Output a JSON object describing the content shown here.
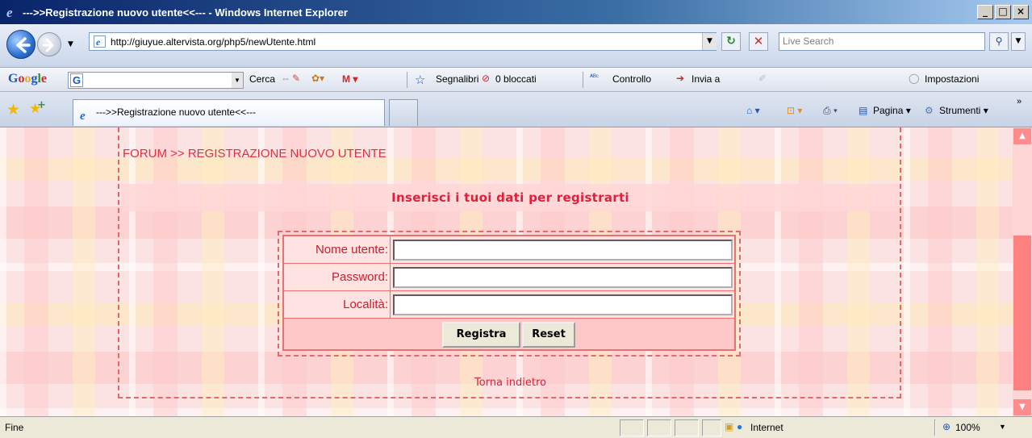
{
  "window": {
    "title": "--->>Registrazione nuovo utente<<--- - Windows Internet Explorer",
    "controls": [
      "_",
      "□",
      "×"
    ]
  },
  "address_bar": {
    "url": "http://giuyue.altervista.org/php5/newUtente.html",
    "search_placeholder": "Live Search"
  },
  "google_toolbar": {
    "search_button": "Cerca",
    "bookmarks": "Segnalibri",
    "blocked": "0 bloccati",
    "spellcheck": "Controllo",
    "send_to": "Invia a",
    "settings": "Impostazioni"
  },
  "tabs": {
    "active_tab": "--->>Registrazione nuovo utente<<---"
  },
  "command_bar": {
    "page": "Pagina",
    "tools": "Strumenti"
  },
  "page": {
    "breadcrumb": "FORUM >> REGISTRAZIONE NUOVO UTENTE",
    "heading": "Inserisci i tuoi dati per registrarti",
    "form": {
      "username_label": "Nome utente:",
      "password_label": "Password:",
      "location_label": "Località:",
      "username_value": "",
      "password_value": "",
      "location_value": "",
      "submit_label": "Registra",
      "reset_label": "Reset"
    },
    "back_link": "Torna indietro"
  },
  "status_bar": {
    "status": "Fine",
    "zone": "Internet",
    "zoom": "100%"
  },
  "colors": {
    "accent_red": "#e0203a",
    "dashed_border": "#e06a6a",
    "scrollbar": "#ff8080"
  }
}
